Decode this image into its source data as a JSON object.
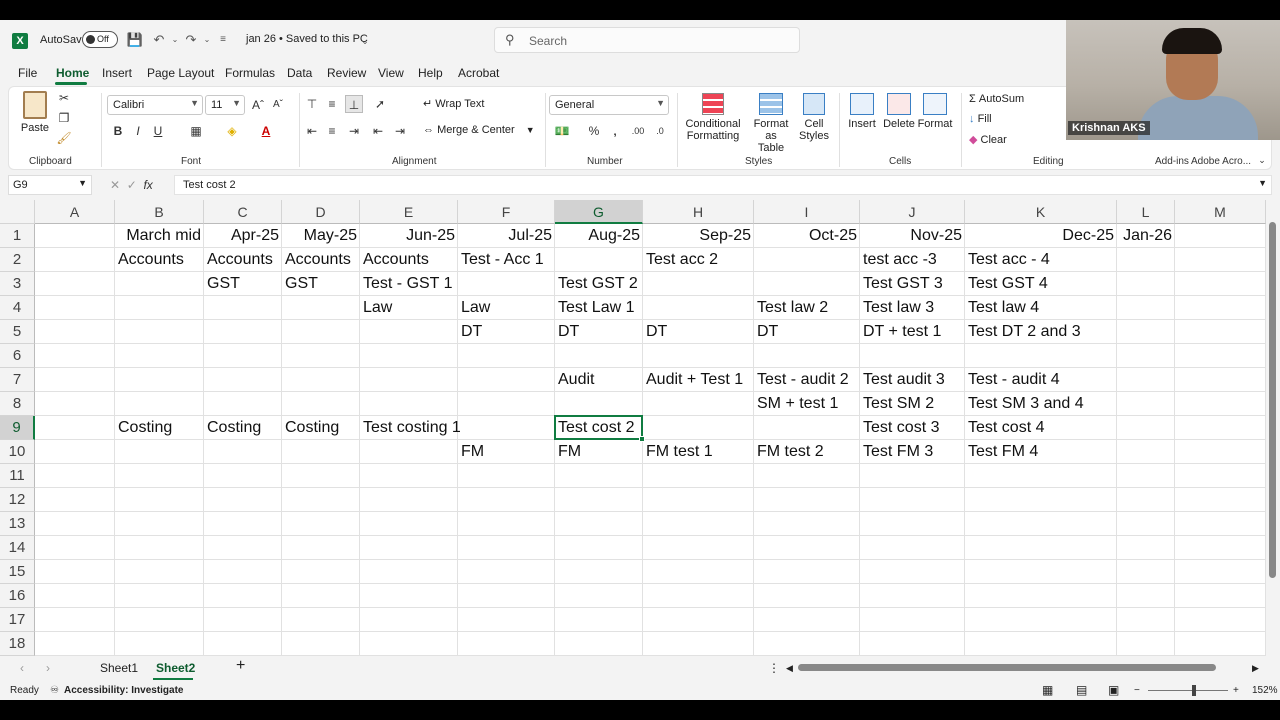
{
  "app": {
    "autosave_label": "AutoSave",
    "autosave_state": "Off",
    "doc_title": "jan 26 • Saved to this PC",
    "search_placeholder": "Search"
  },
  "menu": [
    "File",
    "Home",
    "Insert",
    "Page Layout",
    "Formulas",
    "Data",
    "Review",
    "View",
    "Help",
    "Acrobat"
  ],
  "ribbon": {
    "clipboard": {
      "paste": "Paste",
      "label": "Clipboard"
    },
    "font": {
      "name": "Calibri",
      "size": "11",
      "bold": "B",
      "italic": "I",
      "underline": "U",
      "label": "Font"
    },
    "alignment": {
      "wrap": "Wrap Text",
      "merge": "Merge & Center",
      "label": "Alignment"
    },
    "number": {
      "format": "General",
      "label": "Number"
    },
    "styles": {
      "conditional_1": "Conditional",
      "conditional_2": "Formatting",
      "format_table_1": "Format as",
      "format_table_2": "Table",
      "cell_styles_1": "Cell",
      "cell_styles_2": "Styles",
      "label": "Styles"
    },
    "cells": {
      "insert": "Insert",
      "delete": "Delete",
      "format": "Format",
      "label": "Cells"
    },
    "editing": {
      "autosum": "AutoSum",
      "fill": "Fill",
      "clear": "Clear",
      "label": "Editing"
    },
    "addins": {
      "label": "Add-ins"
    },
    "adobe": {
      "label": "Adobe Acro..."
    }
  },
  "formula_bar": {
    "name_box": "G9",
    "fx": "fx",
    "value": "Test cost 2"
  },
  "columns": [
    "A",
    "B",
    "C",
    "D",
    "E",
    "F",
    "G",
    "H",
    "I",
    "J",
    "K",
    "L",
    "M"
  ],
  "rows": [
    "1",
    "2",
    "3",
    "4",
    "5",
    "6",
    "7",
    "8",
    "9",
    "10",
    "11",
    "12",
    "13",
    "14",
    "15",
    "16",
    "17",
    "18"
  ],
  "cells": {
    "r1": {
      "B": "March mid",
      "C": "Apr-25",
      "D": "May-25",
      "E": "Jun-25",
      "F": "Jul-25",
      "G": "Aug-25",
      "H": "Sep-25",
      "I": "Oct-25",
      "J": "Nov-25",
      "K": "Dec-25",
      "L": "Jan-26"
    },
    "r2": {
      "B": "Accounts",
      "C": "Accounts",
      "D": "Accounts",
      "E": "Accounts",
      "F": "Test - Acc 1",
      "H": "Test acc 2",
      "J": "test acc -3",
      "K": "Test acc - 4"
    },
    "r3": {
      "C": "GST",
      "D": "GST",
      "E": "Test - GST 1",
      "G": "Test GST 2",
      "J": "Test GST 3",
      "K": "Test GST 4"
    },
    "r4": {
      "E": "Law",
      "F": "Law",
      "G": "Test Law 1",
      "I": "Test law 2",
      "J": "Test law 3",
      "K": "Test law 4"
    },
    "r5": {
      "F": "DT",
      "G": "DT",
      "H": "DT",
      "I": "DT",
      "J": "DT + test 1",
      "K": "Test DT 2 and 3"
    },
    "r7": {
      "G": "Audit",
      "H": "Audit + Test 1",
      "I": "Test - audit 2",
      "J": "Test audit 3",
      "K": "Test - audit 4"
    },
    "r8": {
      "I": "SM + test 1",
      "J": "Test SM 2",
      "K": "Test SM 3 and 4"
    },
    "r9": {
      "B": "Costing",
      "C": "Costing",
      "D": "Costing",
      "E": "Test costing 1",
      "G": "Test cost 2",
      "J": "Test cost 3",
      "K": "Test cost 4"
    },
    "r10": {
      "F": "FM",
      "G": "FM",
      "H": "FM test 1",
      "I": "FM test 2",
      "J": "Test FM 3",
      "K": "Test FM 4"
    }
  },
  "sheets": [
    "Sheet1",
    "Sheet2"
  ],
  "status": {
    "ready": "Ready",
    "accessibility": "Accessibility: Investigate",
    "zoom": "152%"
  },
  "webcam": {
    "name": "Krishnan AKS"
  },
  "colors": {
    "excel_green": "#107c41",
    "save_purple": "#b0359c"
  }
}
